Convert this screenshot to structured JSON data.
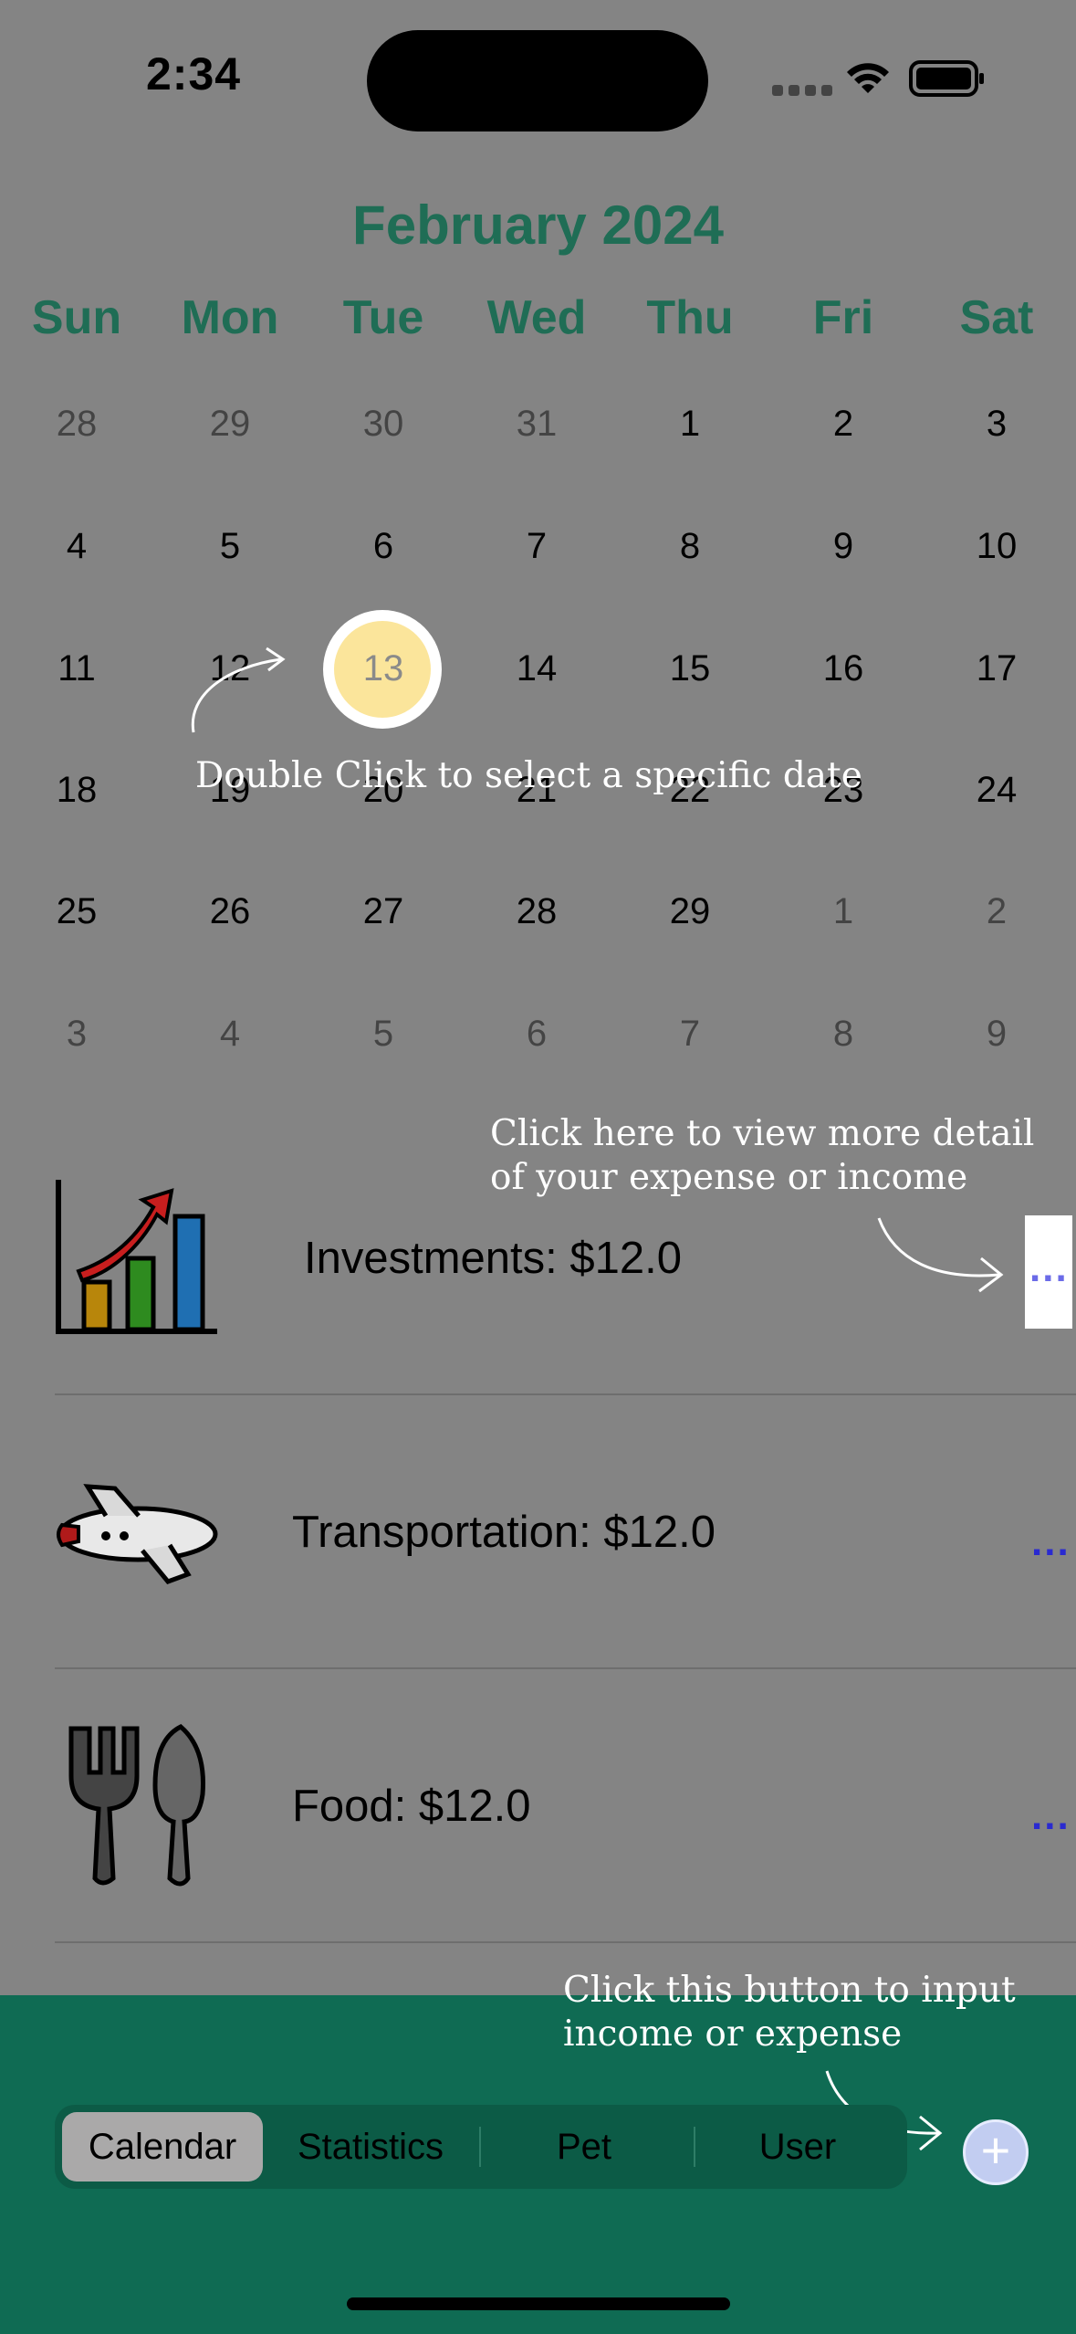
{
  "status_bar": {
    "time": "2:34"
  },
  "calendar": {
    "month_title": "February 2024",
    "weekdays": [
      "Sun",
      "Mon",
      "Tue",
      "Wed",
      "Thu",
      "Fri",
      "Sat"
    ],
    "weeks": [
      [
        "28",
        "29",
        "30",
        "31",
        "1",
        "2",
        "3"
      ],
      [
        "4",
        "5",
        "6",
        "7",
        "8",
        "9",
        "10"
      ],
      [
        "11",
        "12",
        "13",
        "14",
        "15",
        "16",
        "17"
      ],
      [
        "18",
        "19",
        "20",
        "21",
        "22",
        "23",
        "24"
      ],
      [
        "25",
        "26",
        "27",
        "28",
        "29",
        "1",
        "2"
      ],
      [
        "3",
        "4",
        "5",
        "6",
        "7",
        "8",
        "9"
      ]
    ],
    "selected_day": "13"
  },
  "hints": {
    "date_hint": "Double Click to select a specific date",
    "detail_hint": "Click here to view more detail\nof your expense or income",
    "add_hint": "Click this button to input\nincome or expense"
  },
  "entries": [
    {
      "label": "Investments: $12.0",
      "icon": "chart-icon",
      "more": "..."
    },
    {
      "label": "Transportation: $12.0",
      "icon": "airplane-icon",
      "more": "..."
    },
    {
      "label": "Food: $12.0",
      "icon": "utensils-icon",
      "more": "..."
    }
  ],
  "tabs": [
    {
      "label": "Calendar",
      "active": true
    },
    {
      "label": "Statistics",
      "active": false
    },
    {
      "label": "Pet",
      "active": false
    },
    {
      "label": "User",
      "active": false
    }
  ],
  "add_button": {
    "label": "+"
  },
  "colors": {
    "accent": "#1f6d55",
    "bottom_bar": "#0f6b53",
    "selected_day_fill": "#fbe59b",
    "link": "#2a2ad0"
  }
}
